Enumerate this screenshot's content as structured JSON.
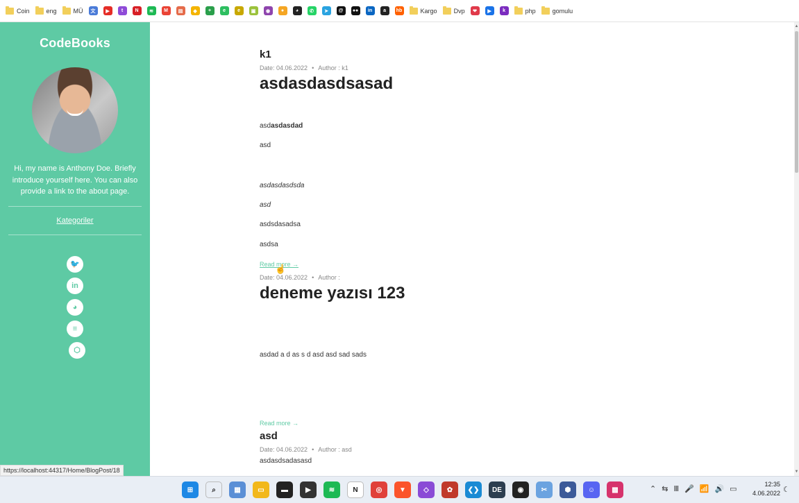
{
  "bookmarks": [
    {
      "label": "Coin",
      "type": "folder"
    },
    {
      "label": "eng",
      "type": "folder"
    },
    {
      "label": "MÜ",
      "type": "folder"
    },
    {
      "label": "",
      "type": "icon",
      "icon": "translate-icon",
      "color": "#4a7bd8",
      "glyph": "文"
    },
    {
      "label": "",
      "type": "icon",
      "icon": "youtube-icon",
      "color": "#e52d27",
      "glyph": "▶"
    },
    {
      "label": "",
      "type": "icon",
      "icon": "twitch-icon",
      "color": "#8f4bd8",
      "glyph": "t"
    },
    {
      "label": "",
      "type": "icon",
      "icon": "netflix-icon",
      "color": "#d81f26",
      "glyph": "N"
    },
    {
      "label": "",
      "type": "icon",
      "icon": "spotify-icon",
      "color": "#1db954",
      "glyph": "≋"
    },
    {
      "label": "",
      "type": "icon",
      "icon": "gmail-icon",
      "color": "#ea4335",
      "glyph": "M"
    },
    {
      "label": "",
      "type": "icon",
      "icon": "slides-icon",
      "color": "#e56b4a",
      "glyph": "▤"
    },
    {
      "label": "",
      "type": "icon",
      "icon": "keep-icon",
      "color": "#f4b400",
      "glyph": "◆"
    },
    {
      "label": "",
      "type": "icon",
      "icon": "sheets-plus-icon",
      "color": "#2a9f4b",
      "glyph": "+"
    },
    {
      "label": "",
      "type": "icon",
      "icon": "evernote-icon",
      "color": "#2dbe60",
      "glyph": "e"
    },
    {
      "label": "",
      "type": "icon",
      "icon": "ebook-icon",
      "color": "#c8a800",
      "glyph": "e"
    },
    {
      "label": "",
      "type": "icon",
      "icon": "photo-icon",
      "color": "#9bc23b",
      "glyph": "▣"
    },
    {
      "label": "",
      "type": "icon",
      "icon": "onion-icon",
      "color": "#8e44ad",
      "glyph": "◉"
    },
    {
      "label": "",
      "type": "icon",
      "icon": "circle-orange-icon",
      "color": "#f5a623",
      "glyph": "●"
    },
    {
      "label": "",
      "type": "icon",
      "icon": "github-icon",
      "color": "#222222",
      "glyph": "◕"
    },
    {
      "label": "",
      "type": "icon",
      "icon": "whatsapp-icon",
      "color": "#25d366",
      "glyph": "✆"
    },
    {
      "label": "",
      "type": "icon",
      "icon": "telegram-icon",
      "color": "#2aa3e0",
      "glyph": "➤"
    },
    {
      "label": "",
      "type": "icon",
      "icon": "threads-icon",
      "color": "#111111",
      "glyph": "@"
    },
    {
      "label": "",
      "type": "icon",
      "icon": "medium-icon",
      "color": "#111111",
      "glyph": "●●"
    },
    {
      "label": "",
      "type": "icon",
      "icon": "linkedin-icon",
      "color": "#0a66c2",
      "glyph": "in"
    },
    {
      "label": "",
      "type": "icon",
      "icon": "amazon-icon",
      "color": "#222222",
      "glyph": "a"
    },
    {
      "label": "",
      "type": "icon",
      "icon": "hepsiburada-icon",
      "color": "#ff6000",
      "glyph": "hb"
    },
    {
      "label": "Kargo",
      "type": "folder"
    },
    {
      "label": "Dvp",
      "type": "folder"
    },
    {
      "label": "",
      "type": "icon",
      "icon": "pocket-icon",
      "color": "#e03a4a",
      "glyph": "❤"
    },
    {
      "label": "",
      "type": "icon",
      "icon": "play-circle-icon",
      "color": "#1a73e8",
      "glyph": "▶"
    },
    {
      "label": "",
      "type": "icon",
      "icon": "k-icon",
      "color": "#7b2cbf",
      "glyph": "k"
    },
    {
      "label": "php",
      "type": "folder"
    },
    {
      "label": "gomulu",
      "type": "folder"
    }
  ],
  "sidebar": {
    "brand": "CodeBooks",
    "intro": "Hi, my name is Anthony Doe. Briefly introduce yourself here. You can also provide a link to the about page.",
    "category_link": "Kategoriler",
    "accent_color": "#5ecaa4",
    "socials": [
      {
        "icon": "twitter-icon",
        "glyph": "🐦"
      },
      {
        "icon": "linkedin-icon",
        "glyph": "in"
      },
      {
        "icon": "github-icon",
        "glyph": "◕"
      },
      {
        "icon": "stackoverflow-icon",
        "glyph": "≡"
      },
      {
        "icon": "codepen-icon",
        "glyph": "⬡"
      }
    ]
  },
  "posts": {
    "p1": {
      "title": "k1",
      "date": "Date: 04.06.2022",
      "author": "Author : k1",
      "heading": "asdasdasdsasad",
      "line1_plain": "asd",
      "line1_bold": "asdasdad",
      "line2": "asd",
      "line3_plain": "asd",
      "line3_italic": "asdasdsda",
      "line4": "asd",
      "line5": "asdsdasadsa",
      "line6": "asdsa",
      "read_more": "Read more →"
    },
    "p2": {
      "date": "Date: 04.06.2022",
      "author": "Author :",
      "heading": "deneme yazısı 123",
      "line1": "asdad a d as s d asd  asd  sad sads",
      "read_more": "Read more →"
    },
    "p3": {
      "title": "asd",
      "date": "Date: 04.06.2022",
      "author": "Author : asd",
      "line1": "asdasdsadasasd"
    },
    "meta_separator": "•"
  },
  "status_url": "https://localhost:44317/Home/BlogPost/18",
  "taskbar": {
    "apps": [
      {
        "icon": "windows-start-icon",
        "color": "#1e88e5",
        "glyph": "⊞"
      },
      {
        "icon": "search-icon",
        "color": "#e9eef5",
        "glyph": "⌕"
      },
      {
        "icon": "photos-icon",
        "color": "#5a8fd6",
        "glyph": "▦"
      },
      {
        "icon": "file-explorer-icon",
        "color": "#f2b81b",
        "glyph": "▭"
      },
      {
        "icon": "terminal-icon",
        "color": "#222222",
        "glyph": "▬"
      },
      {
        "icon": "media-player-icon",
        "color": "#333333",
        "glyph": "▶"
      },
      {
        "icon": "spotify-icon",
        "color": "#1db954",
        "glyph": "≋"
      },
      {
        "icon": "notion-icon",
        "color": "#ffffff",
        "glyph": "N"
      },
      {
        "icon": "chrome-icon",
        "color": "#e0413a",
        "glyph": "◎"
      },
      {
        "icon": "brave-icon",
        "color": "#fb542b",
        "glyph": "▼"
      },
      {
        "icon": "visual-studio-icon",
        "color": "#8a4bd6",
        "glyph": "◇"
      },
      {
        "icon": "davinci-icon",
        "color": "#c0392b",
        "glyph": "✿"
      },
      {
        "icon": "vscode-icon",
        "color": "#1a8ad4",
        "glyph": "❮❯"
      },
      {
        "icon": "devops-icon",
        "color": "#2c3e50",
        "glyph": "DE"
      },
      {
        "icon": "obs-icon",
        "color": "#222222",
        "glyph": "◉"
      },
      {
        "icon": "snipping-tool-icon",
        "color": "#6ba3e0",
        "glyph": "✂"
      },
      {
        "icon": "virtualbox-icon",
        "color": "#3c5a99",
        "glyph": "⬢"
      },
      {
        "icon": "discord-icon",
        "color": "#5865f2",
        "glyph": "☺"
      },
      {
        "icon": "colorful-app-icon",
        "color": "#d6336c",
        "glyph": "▩"
      }
    ],
    "tray": [
      "⌃",
      "⇆",
      "Ⅲ",
      "🎤",
      "📶",
      "🔊",
      "▭"
    ],
    "time": "12:35",
    "date": "4.06.2022"
  }
}
